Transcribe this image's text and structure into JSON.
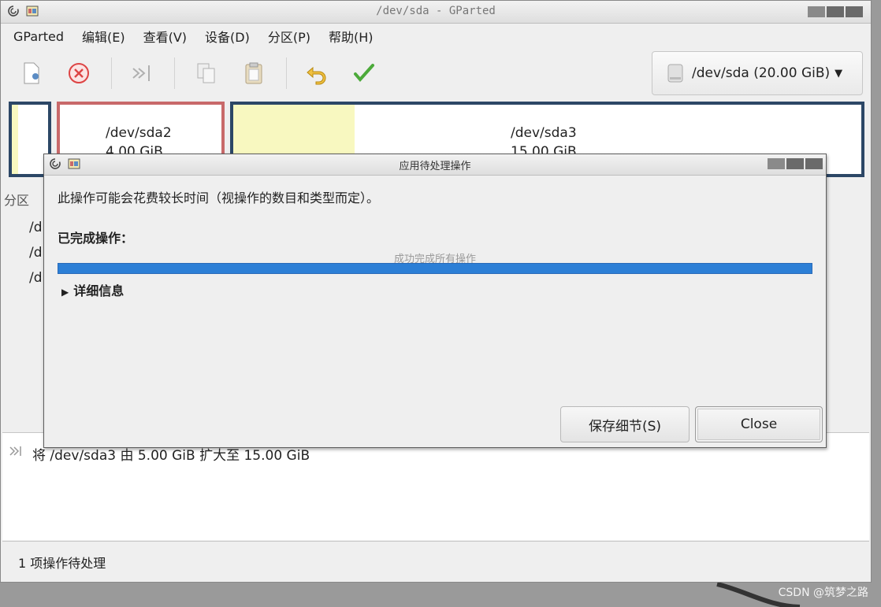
{
  "main_window": {
    "title": "/dev/sda - GParted",
    "menus": [
      "GParted",
      "编辑(E)",
      "查看(V)",
      "设备(D)",
      "分区(P)",
      "帮助(H)"
    ],
    "toolbar_icons": [
      "new-icon",
      "delete-icon",
      "apply-resize-icon",
      "copy-icon",
      "paste-icon",
      "undo-icon",
      "apply-icon"
    ],
    "device_selector": "/dev/sda (20.00 GiB)",
    "partitions": [
      {
        "name": "/dev/sda2",
        "size": "4.00 GiB"
      },
      {
        "name": "/dev/sda3",
        "size": "15.00 GiB"
      }
    ],
    "list_column_header": "分区",
    "list_rows": [
      "/d",
      "/d",
      "/d"
    ],
    "pending_operation": "将 /dev/sda3 由 5.00 GiB 扩大至 15.00 GiB",
    "status": "1 项操作待处理"
  },
  "dialog": {
    "title": "应用待处理操作",
    "message": "此操作可能会花费较长时间（视操作的数目和类型而定）。",
    "completed_label": "已完成操作：",
    "progress_text": "成功完成所有操作",
    "progress_fraction": 1.0,
    "details_label": "详细信息",
    "save_button": "保存细节(S)",
    "close_button": "Close"
  },
  "watermark": "CSDN @筑梦之路",
  "colors": {
    "progress": "#2c7fd6",
    "unallocated": "#f8f8c0",
    "selected_partition": "#c8696a",
    "partition_border": "#2c4766"
  }
}
